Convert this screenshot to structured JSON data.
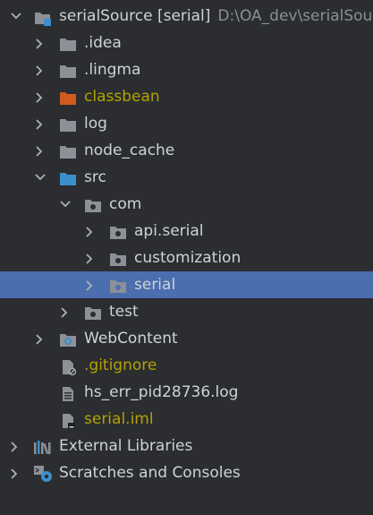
{
  "project": {
    "name": "serialSource",
    "module": "[serial]",
    "path": "D:\\OA_dev\\serialSource"
  },
  "nodes": {
    "idea": ".idea",
    "lingma": ".lingma",
    "classbean": "classbean",
    "log": "log",
    "node_cache": "node_cache",
    "src": "src",
    "com": "com",
    "api_serial": "api.serial",
    "customization": "customization",
    "serial": "serial",
    "test": "test",
    "webcontent": "WebContent",
    "gitignore": ".gitignore",
    "hs_err": "hs_err_pid28736.log",
    "serial_iml": "serial.iml",
    "external_libraries": "External Libraries",
    "scratches": "Scratches and Consoles"
  },
  "colors": {
    "background": "#2b2d30",
    "selection": "#4b6eaf",
    "text": "#cfd2d6",
    "muted_text": "#8c8f93",
    "ignored_text": "#b3a200",
    "folder": "#8d9096",
    "excluded_folder": "#d35a1f",
    "source_folder": "#3c8fcd"
  }
}
